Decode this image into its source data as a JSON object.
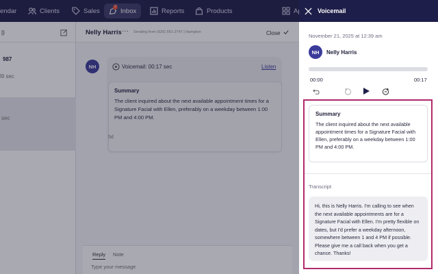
{
  "nav": {
    "items": [
      {
        "label": "endar",
        "icon": "calendar-icon"
      },
      {
        "label": "Clients",
        "icon": "people-icon"
      },
      {
        "label": "Sales",
        "icon": "tag-icon"
      },
      {
        "label": "Inbox",
        "icon": "inbox-icon"
      },
      {
        "label": "Reports",
        "icon": "bar-chart-icon"
      },
      {
        "label": "Products",
        "icon": "bag-icon"
      },
      {
        "label": "Ap",
        "icon": "grid-icon"
      }
    ],
    "inbox_badge": "2"
  },
  "list": {
    "filter_label": "|)",
    "rows": [
      {
        "text": "987"
      },
      {
        "text": "l9 sec"
      },
      {
        "text": "sec"
      }
    ]
  },
  "conversation": {
    "contact_name": "Nelly Harris",
    "sending_from": "Sending from (626) 561-2747 | Hampton",
    "close_label": "Close",
    "avatar_initials": "NH",
    "voicemail_label": "Voicemail: 00:17 sec",
    "listen_label": "Listen",
    "summary_title": "Summary",
    "summary_text": "The client inquired about the next available appointment times for a Signature Facial with Ellen, preferably on a weekday between 1:00 PM and 4:00 PM.",
    "age": "5d",
    "reply_tab": "Reply",
    "note_tab": "Note",
    "reply_placeholder": "Type your message"
  },
  "voicemail_panel": {
    "title": "Voicemail",
    "timestamp": "November 21, 2025 at 12:39 am",
    "avatar_initials": "NH",
    "contact_name": "Nelly Harris",
    "progress": 0,
    "time_current": "00:00",
    "time_total": "00:17",
    "summary_title": "Summary",
    "summary_text": "The client inquired about the next available appointment times for a Signature Facial with Ellen, preferably on a weekday between 1:00 PM and 4:00 PM.",
    "transcript_label": "Transcript",
    "transcript_text": "Hi, this is Nelly Harris. I'm calling to see when the next available appointments are for a Signature Facial with Ellen. I'm pretty flexible on dates, but I'd prefer a weekday afternoon, somewhere between 1 and 4 PM if possible. Please give me a call back when you get a chance. Thanks!"
  },
  "colors": {
    "nav_bg": "#1e1e4a",
    "accent": "#3b3b9a",
    "highlight_border": "#b0296a"
  }
}
